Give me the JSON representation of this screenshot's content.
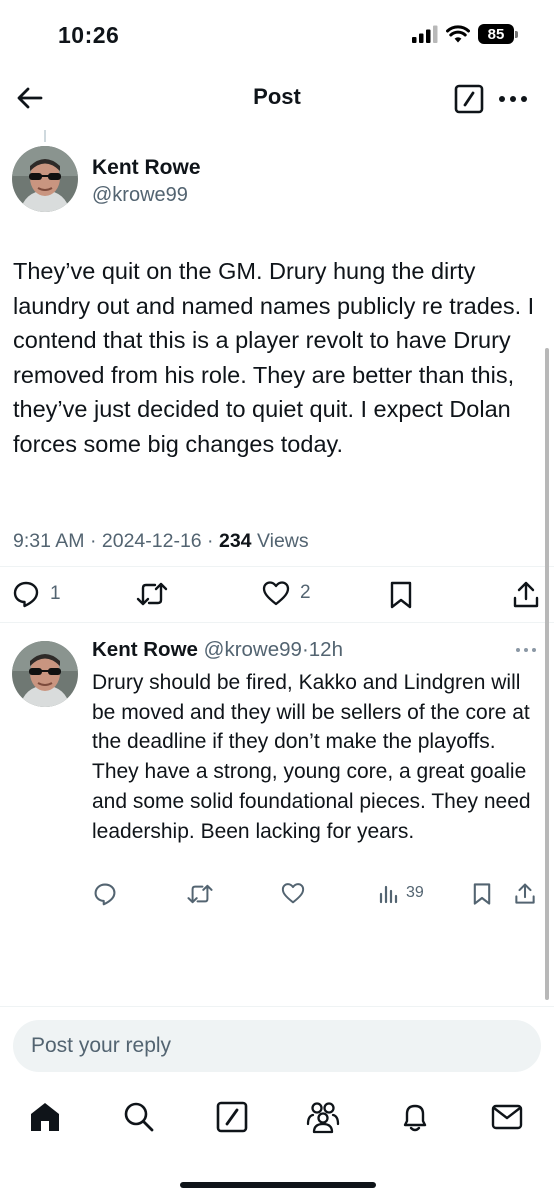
{
  "status_bar": {
    "time": "10:26",
    "battery": "85",
    "icons": [
      "signal-icon",
      "wifi-icon",
      "battery-icon"
    ]
  },
  "header": {
    "title": "Post",
    "icons": [
      "back-arrow-icon",
      "edit-icon",
      "more-horizontal-icon"
    ]
  },
  "post": {
    "author_name": "Kent Rowe",
    "author_handle": "@krowe99",
    "text": "They’ve quit on the GM. Drury hung the dirty laundry out and named names publicly re trades. I contend that this is a player revolt to have Drury removed from his role. They are better than this, they’ve just decided to quiet quit. I expect Dolan forces some big changes today.",
    "time": "9:31 AM",
    "date": "2024-12-16",
    "separator": " · ",
    "views_count": "234",
    "views_label": "Views",
    "actions": {
      "replies": "1",
      "retweets": "",
      "likes": "2"
    }
  },
  "reply": {
    "author_name": "Kent Rowe",
    "author_handle": "@krowe99",
    "separator": "·",
    "age": "12h",
    "text": "Drury should be fired, Kakko and Lindgren will be moved and they will be sellers of the core at the deadline if they don’t make the playoffs. They have a strong, young core, a great goalie and some solid foundational pieces. They need leadership. Been lacking for years.",
    "actions": {
      "views": "39"
    }
  },
  "composer": {
    "placeholder": "Post your reply"
  },
  "tab_bar": {
    "items": [
      "home-icon",
      "search-icon",
      "grok-icon",
      "communities-icon",
      "notifications-icon",
      "messages-icon"
    ]
  },
  "colors": {
    "text": "#0f1419",
    "secondary": "#536471",
    "divider": "#eff3f4",
    "composer_bg": "#eff3f4"
  }
}
